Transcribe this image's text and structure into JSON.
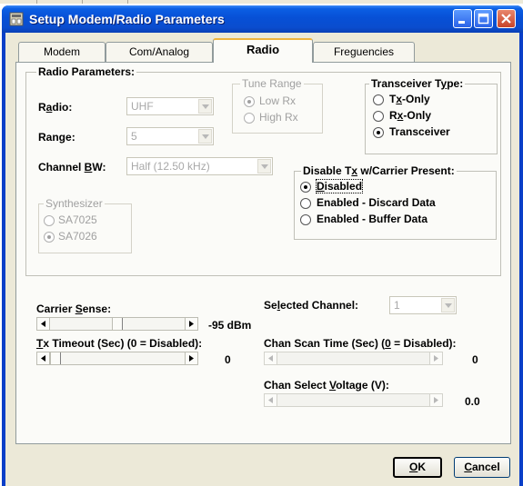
{
  "window": {
    "title": "Setup Modem/Radio Parameters"
  },
  "tabs": [
    {
      "label": "Modem"
    },
    {
      "label": "Com/Analog"
    },
    {
      "label": "Radio"
    },
    {
      "label": "Freguencies"
    }
  ],
  "radio_params": {
    "legend": "Radio Parameters:",
    "radio_label": "Radio:",
    "radio_value": "UHF",
    "range_label": "Range:",
    "range_value": "5",
    "channel_bw_label": "Channel BW:",
    "channel_bw_value": "Half (12.50 kHz)"
  },
  "tune_range": {
    "legend": "Tune Range",
    "options": [
      "Low Rx",
      "High Rx"
    ],
    "selected": 0
  },
  "transceiver_type": {
    "legend": "Transceiver Type:",
    "options": [
      "Tx-Only",
      "Rx-Only",
      "Transceiver"
    ],
    "selected": 2
  },
  "synthesizer": {
    "legend": "Synthesizer",
    "options": [
      "SA7025",
      "SA7026"
    ],
    "selected": 1
  },
  "disable_tx": {
    "legend": "Disable Tx w/Carrier Present:",
    "options": [
      "Disabled",
      "Enabled - Discard Data",
      "Enabled - Buffer Data"
    ],
    "selected": 0
  },
  "carrier_sense": {
    "label": "Carrier Sense:",
    "value": "-95 dBm",
    "level": 0.5
  },
  "selected_channel": {
    "label": "Selected Channel:",
    "value": "1"
  },
  "tx_timeout": {
    "label": "Tx Timeout (Sec) (0 = Disabled):",
    "value": "0",
    "level": 0
  },
  "chan_scan_time": {
    "label": "Chan Scan Time (Sec) (0 = Disabled):",
    "value": "0",
    "level": 0
  },
  "chan_select_voltage": {
    "label": "Chan Select Voltage (V):",
    "value": "0.0",
    "level": 0
  },
  "buttons": {
    "ok": "OK",
    "cancel": "Cancel"
  }
}
